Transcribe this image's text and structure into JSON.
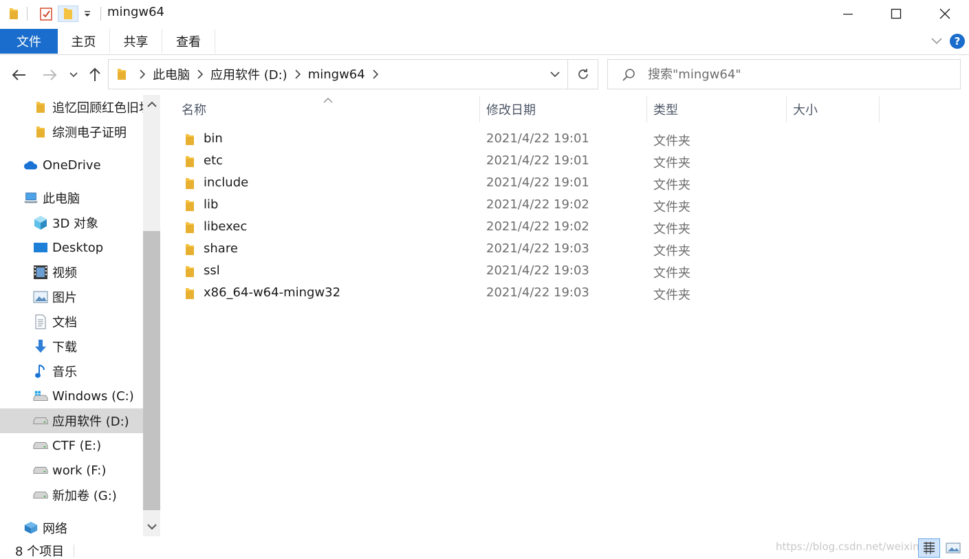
{
  "window": {
    "title": "mingw64"
  },
  "ribbon": {
    "tabs": [
      {
        "label": "文件"
      },
      {
        "label": "主页"
      },
      {
        "label": "共享"
      },
      {
        "label": "查看"
      }
    ]
  },
  "address": {
    "crumbs": [
      "此电脑",
      "应用软件 (D:)",
      "mingw64"
    ]
  },
  "search": {
    "placeholder": "搜索\"mingw64\""
  },
  "sidebar": {
    "items": [
      {
        "label": "追忆回顾红色旧址",
        "icon": "folder-icon",
        "level": 2
      },
      {
        "label": "综测电子证明",
        "icon": "folder-icon",
        "level": 2
      },
      {
        "label": "OneDrive",
        "icon": "cloud-icon",
        "level": 1
      },
      {
        "label": "此电脑",
        "icon": "computer-icon",
        "level": 1
      },
      {
        "label": "3D 对象",
        "icon": "cube-icon",
        "level": 2
      },
      {
        "label": "Desktop",
        "icon": "desktop-icon",
        "level": 2
      },
      {
        "label": "视频",
        "icon": "video-icon",
        "level": 2
      },
      {
        "label": "图片",
        "icon": "picture-icon",
        "level": 2
      },
      {
        "label": "文档",
        "icon": "document-icon",
        "level": 2
      },
      {
        "label": "下载",
        "icon": "download-icon",
        "level": 2
      },
      {
        "label": "音乐",
        "icon": "music-icon",
        "level": 2
      },
      {
        "label": "Windows (C:)",
        "icon": "windows-drive-icon",
        "level": 2
      },
      {
        "label": "应用软件 (D:)",
        "icon": "drive-icon",
        "level": 2,
        "selected": true
      },
      {
        "label": "CTF (E:)",
        "icon": "drive-icon",
        "level": 2
      },
      {
        "label": "work (F:)",
        "icon": "drive-icon",
        "level": 2
      },
      {
        "label": "新加卷 (G:)",
        "icon": "drive-icon",
        "level": 2
      },
      {
        "label": "网络",
        "icon": "network-icon",
        "level": 1
      }
    ]
  },
  "columns": {
    "name": "名称",
    "date": "修改日期",
    "type": "类型",
    "size": "大小"
  },
  "files": [
    {
      "name": "bin",
      "date": "2021/4/22 19:01",
      "type": "文件夹"
    },
    {
      "name": "etc",
      "date": "2021/4/22 19:01",
      "type": "文件夹"
    },
    {
      "name": "include",
      "date": "2021/4/22 19:01",
      "type": "文件夹"
    },
    {
      "name": "lib",
      "date": "2021/4/22 19:02",
      "type": "文件夹"
    },
    {
      "name": "libexec",
      "date": "2021/4/22 19:02",
      "type": "文件夹"
    },
    {
      "name": "share",
      "date": "2021/4/22 19:03",
      "type": "文件夹"
    },
    {
      "name": "ssl",
      "date": "2021/4/22 19:03",
      "type": "文件夹"
    },
    {
      "name": "x86_64-w64-mingw32",
      "date": "2021/4/22 19:03",
      "type": "文件夹"
    }
  ],
  "status": {
    "count": "8 个项目"
  },
  "watermark": "https://blog.csdn.net/weixin_",
  "colors": {
    "accent": "#1a6dcc",
    "folder": "#f5c342",
    "selected": "#d9d9d9"
  }
}
